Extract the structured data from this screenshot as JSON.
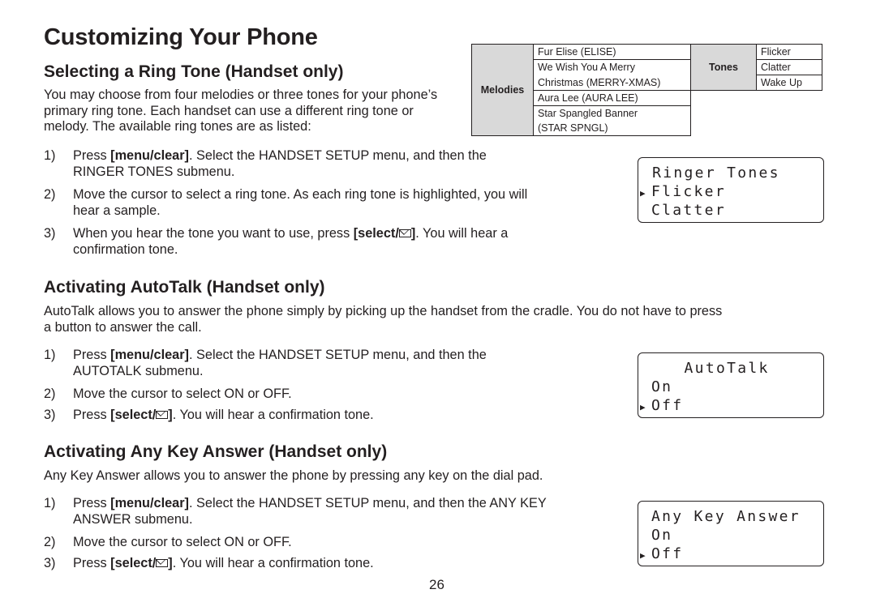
{
  "page": {
    "title": "Customizing Your Phone",
    "page_number": "26"
  },
  "ring_tone": {
    "heading": "Selecting a Ring Tone (Handset only)",
    "intro": "You may choose from four melodies or three tones for your phone’s primary ring tone. Each handset can use a different ring tone or melody. The available ring tones are as listed:",
    "table": {
      "melodies_label": "Melodies",
      "melodies": [
        "Fur Elise (ELISE)",
        "We Wish You A Merry",
        "Christmas (MERRY-XMAS)",
        "Aura Lee (AURA LEE)",
        "Star Spangled Banner",
        "(STAR SPNGL)"
      ],
      "tones_label": "Tones",
      "tones": [
        "Flicker",
        "Clatter",
        "Wake Up"
      ]
    },
    "steps": [
      {
        "num": "1)",
        "pre": "Press ",
        "bold": "[menu/clear]",
        "post": ". Select the HANDSET SETUP menu, and then the",
        "line2": "RINGER TONES submenu."
      },
      {
        "num": "2)",
        "text": "Move the cursor to select a ring tone. As each ring tone is highlighted, you will",
        "line2": "hear a sample."
      },
      {
        "num": "3)",
        "pre": "When you hear the tone you want to use, press ",
        "bold": "[select/",
        "bold_end": "]",
        "post": ". You will hear a",
        "line2": "confirmation tone."
      }
    ],
    "lcd": {
      "title": " Ringer Tones",
      "selected": "Flicker",
      "other": "Clatter",
      "cursor": "▶"
    }
  },
  "autotalk": {
    "heading": "Activating AutoTalk (Handset only)",
    "intro_line1": "AutoTalk allows you to answer the phone simply by picking up the handset from the cradle. You do not have to press",
    "intro_line2": "a button to answer the call.",
    "steps": [
      {
        "num": "1)",
        "pre": "Press ",
        "bold": "[menu/clear]",
        "post": ". Select the HANDSET SETUP menu, and then the",
        "line2": "AUTOTALK submenu."
      },
      {
        "num": "2)",
        "text": "Move the cursor to select ON or OFF."
      },
      {
        "num": "3)",
        "pre": "Press ",
        "bold": "[select/",
        "bold_end": "]",
        "post": ". You will hear a confirmation tone."
      }
    ],
    "lcd": {
      "title": "    AutoTalk",
      "on": "On",
      "off": "Off",
      "cursor": "▶"
    }
  },
  "anykey": {
    "heading": "Activating Any Key Answer (Handset only)",
    "intro": "Any Key Answer allows you to answer the phone by pressing any key on the dial pad.",
    "steps": [
      {
        "num": "1)",
        "pre": "Press ",
        "bold": "[menu/clear]",
        "post": ". Select the HANDSET SETUP menu, and then the ANY KEY",
        "line2": "ANSWER submenu."
      },
      {
        "num": "2)",
        "text": "Move the cursor to select ON or OFF."
      },
      {
        "num": "3)",
        "pre": "Press ",
        "bold": "[select/",
        "bold_end": "]",
        "post": ". You will hear a confirmation tone."
      }
    ],
    "lcd": {
      "title": "Any Key Answer",
      "on": "On",
      "off": "Off",
      "cursor": "▶"
    }
  }
}
